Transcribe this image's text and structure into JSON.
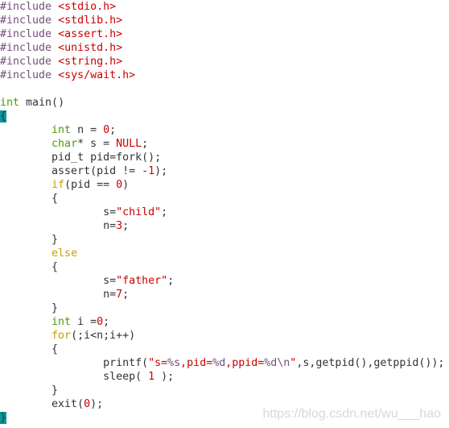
{
  "editor": {
    "colors": {
      "preproc": "#75507b",
      "string": "#cc0000",
      "type": "#4e9a06",
      "statement": "#c4a000",
      "match_bg": "#06989a"
    },
    "lines": [
      [
        [
          "#include ",
          "p"
        ],
        [
          "<stdio.h>",
          "s"
        ]
      ],
      [
        [
          "#include ",
          "p"
        ],
        [
          "<stdlib.h>",
          "s"
        ]
      ],
      [
        [
          "#include ",
          "p"
        ],
        [
          "<assert.h>",
          "s"
        ]
      ],
      [
        [
          "#include ",
          "p"
        ],
        [
          "<unistd.h>",
          "s"
        ]
      ],
      [
        [
          "#include ",
          "p"
        ],
        [
          "<string.h>",
          "s"
        ]
      ],
      [
        [
          "#include ",
          "p"
        ],
        [
          "<sys/wait.h>",
          "s"
        ]
      ],
      [],
      [
        [
          "int",
          "t"
        ],
        [
          " main()",
          "n"
        ]
      ],
      [
        [
          "{",
          "m"
        ]
      ],
      [
        [
          "\t",
          "n"
        ],
        [
          "int",
          "t"
        ],
        [
          " n = ",
          "n"
        ],
        [
          "0",
          "c"
        ],
        [
          ";",
          "n"
        ]
      ],
      [
        [
          "\t",
          "n"
        ],
        [
          "char",
          "t"
        ],
        [
          "* s = ",
          "n"
        ],
        [
          "NULL",
          "c"
        ],
        [
          ";",
          "n"
        ]
      ],
      [
        [
          "\tpid_t pid=fork();",
          "n"
        ]
      ],
      [
        [
          "\tassert(pid != ",
          "n"
        ],
        [
          "-1",
          "c"
        ],
        [
          ");",
          "n"
        ]
      ],
      [
        [
          "\t",
          "n"
        ],
        [
          "if",
          "k"
        ],
        [
          "(pid == ",
          "n"
        ],
        [
          "0",
          "c"
        ],
        [
          ")",
          "n"
        ]
      ],
      [
        [
          "\t{",
          "n"
        ]
      ],
      [
        [
          "\t\ts=",
          "n"
        ],
        [
          "\"child\"",
          "s"
        ],
        [
          ";",
          "n"
        ]
      ],
      [
        [
          "\t\tn=",
          "n"
        ],
        [
          "3",
          "c"
        ],
        [
          ";",
          "n"
        ]
      ],
      [
        [
          "\t}",
          "n"
        ]
      ],
      [
        [
          "\t",
          "n"
        ],
        [
          "else",
          "k"
        ]
      ],
      [
        [
          "\t{",
          "n"
        ]
      ],
      [
        [
          "\t\ts=",
          "n"
        ],
        [
          "\"father\"",
          "s"
        ],
        [
          ";",
          "n"
        ]
      ],
      [
        [
          "\t\tn=",
          "n"
        ],
        [
          "7",
          "c"
        ],
        [
          ";",
          "n"
        ]
      ],
      [
        [
          "\t}",
          "n"
        ]
      ],
      [
        [
          "\t",
          "n"
        ],
        [
          "int",
          "t"
        ],
        [
          " i =",
          "n"
        ],
        [
          "0",
          "c"
        ],
        [
          ";",
          "n"
        ]
      ],
      [
        [
          "\t",
          "n"
        ],
        [
          "for",
          "k"
        ],
        [
          "(;i<n;i++)",
          "n"
        ]
      ],
      [
        [
          "\t{",
          "n"
        ]
      ],
      [
        [
          "\t\tprintf(",
          "n"
        ],
        [
          "\"s=",
          "s"
        ],
        [
          "%s",
          "sp"
        ],
        [
          ",pid=",
          "s"
        ],
        [
          "%d",
          "sp"
        ],
        [
          ",ppid=",
          "s"
        ],
        [
          "%d\\n",
          "sp"
        ],
        [
          "\"",
          "s"
        ],
        [
          ",s,getpid(),getppid());",
          "n"
        ]
      ],
      [
        [
          "\t\tsleep( ",
          "n"
        ],
        [
          "1",
          "c"
        ],
        [
          " );",
          "n"
        ]
      ],
      [
        [
          "\t}",
          "n"
        ]
      ],
      [
        [
          "\texit(",
          "n"
        ],
        [
          "0",
          "c"
        ],
        [
          ");",
          "n"
        ]
      ],
      [
        [
          "}",
          "m"
        ]
      ]
    ]
  },
  "watermark": "https://blog.csdn.net/wu___hao"
}
